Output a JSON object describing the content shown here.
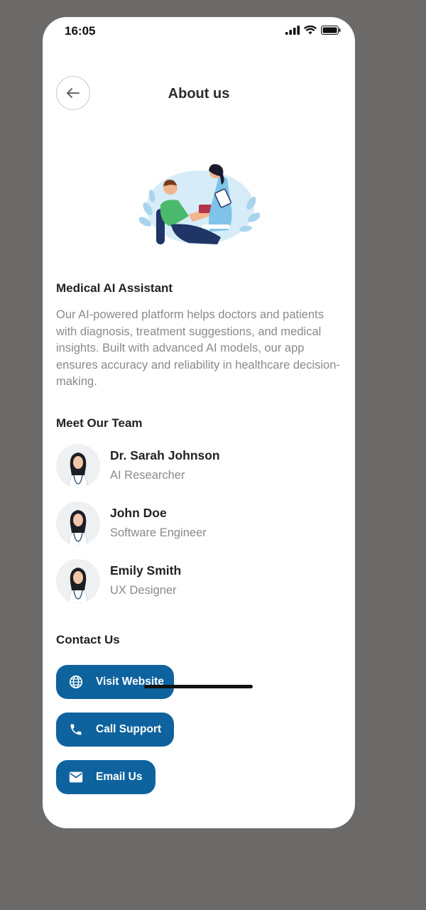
{
  "status_bar": {
    "time": "16:05",
    "icons": [
      "signal-icon",
      "wifi-icon",
      "battery-icon"
    ]
  },
  "header": {
    "title": "About us",
    "back_icon": "arrow-left-icon"
  },
  "hero": {
    "illustration": "doctor-patient-illustration"
  },
  "about": {
    "title": "Medical AI Assistant",
    "description": "Our AI-powered platform helps doctors and patients with diagnosis, treatment suggestions, and medical insights. Built with advanced AI models, our app ensures accuracy and reliability in healthcare decision-making."
  },
  "team": {
    "title": "Meet Our Team",
    "members": [
      {
        "name": "Dr. Sarah Johnson",
        "role": "AI Researcher"
      },
      {
        "name": "John Doe",
        "role": "Software Engineer"
      },
      {
        "name": "Emily Smith",
        "role": "UX Designer"
      }
    ]
  },
  "contact": {
    "title": "Contact Us",
    "buttons": [
      {
        "label": "Visit Website",
        "icon": "globe-icon"
      },
      {
        "label": "Call Support",
        "icon": "phone-icon"
      },
      {
        "label": "Email Us",
        "icon": "mail-icon"
      }
    ]
  },
  "colors": {
    "accent": "#0e639e",
    "background": "#6b6a68",
    "muted_text": "#8a8a8a"
  }
}
